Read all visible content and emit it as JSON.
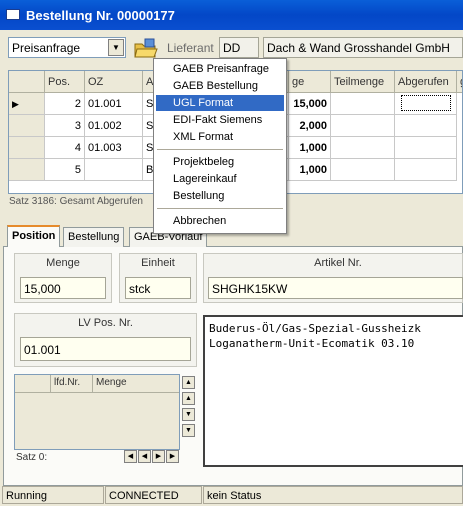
{
  "window": {
    "title": "Bestellung Nr. 00000177"
  },
  "toolbar": {
    "type_select": "Preisanfrage",
    "lieferant_label": "Lieferant",
    "lieferant_code": "DD",
    "lieferant_name": "Dach & Wand Grosshandel GmbH"
  },
  "grid": {
    "columns": [
      "Pos.",
      "OZ",
      "A",
      "ge",
      "Teilmenge",
      "Abgerufen",
      "g"
    ],
    "rows": [
      {
        "pos": "2",
        "oz": "01.001",
        "a": "S",
        "menge": "15,000"
      },
      {
        "pos": "3",
        "oz": "01.002",
        "a": "S",
        "menge": "2,000"
      },
      {
        "pos": "4",
        "oz": "01.003",
        "a": "S",
        "menge": "1,000"
      },
      {
        "pos": "5",
        "oz": "",
        "a": "B",
        "menge": "1,000"
      }
    ],
    "footer": "Satz 3186: Gesamt Abgerufen"
  },
  "menu": {
    "items": [
      "GAEB Preisanfrage",
      "GAEB Bestellung",
      "UGL Format",
      "EDI-Fakt Siemens",
      "XML Format"
    ],
    "items2": [
      "Projektbeleg",
      "Lagereinkauf",
      "Bestellung"
    ],
    "cancel": "Abbrechen",
    "selected": "UGL Format"
  },
  "tabs": [
    "Position",
    "Bestellung",
    "GAEB-Vorlauf"
  ],
  "position": {
    "menge_label": "Menge",
    "menge_value": "15,000",
    "einheit_label": "Einheit",
    "einheit_value": "stck",
    "artikel_label": "Artikel Nr.",
    "artikel_value": "SHGHK15KW",
    "lvpos_label": "LV Pos. Nr.",
    "lvpos_value": "01.001",
    "desc_line1": "Buderus-Öl/Gas-Spezial-Gussheizk",
    "desc_line2": "Loganatherm-Unit-Ecomatik 03.10",
    "sub_cols": [
      "lfd.Nr.",
      "Menge"
    ],
    "sub_footer": "Satz 0:"
  },
  "status": {
    "s1": "Running",
    "s2": "CONNECTED",
    "s3": "kein Status"
  },
  "colors": {
    "title_bar": "#0a5fd8",
    "selection": "#316ac5",
    "dialog_bg": "#ece9d8"
  }
}
